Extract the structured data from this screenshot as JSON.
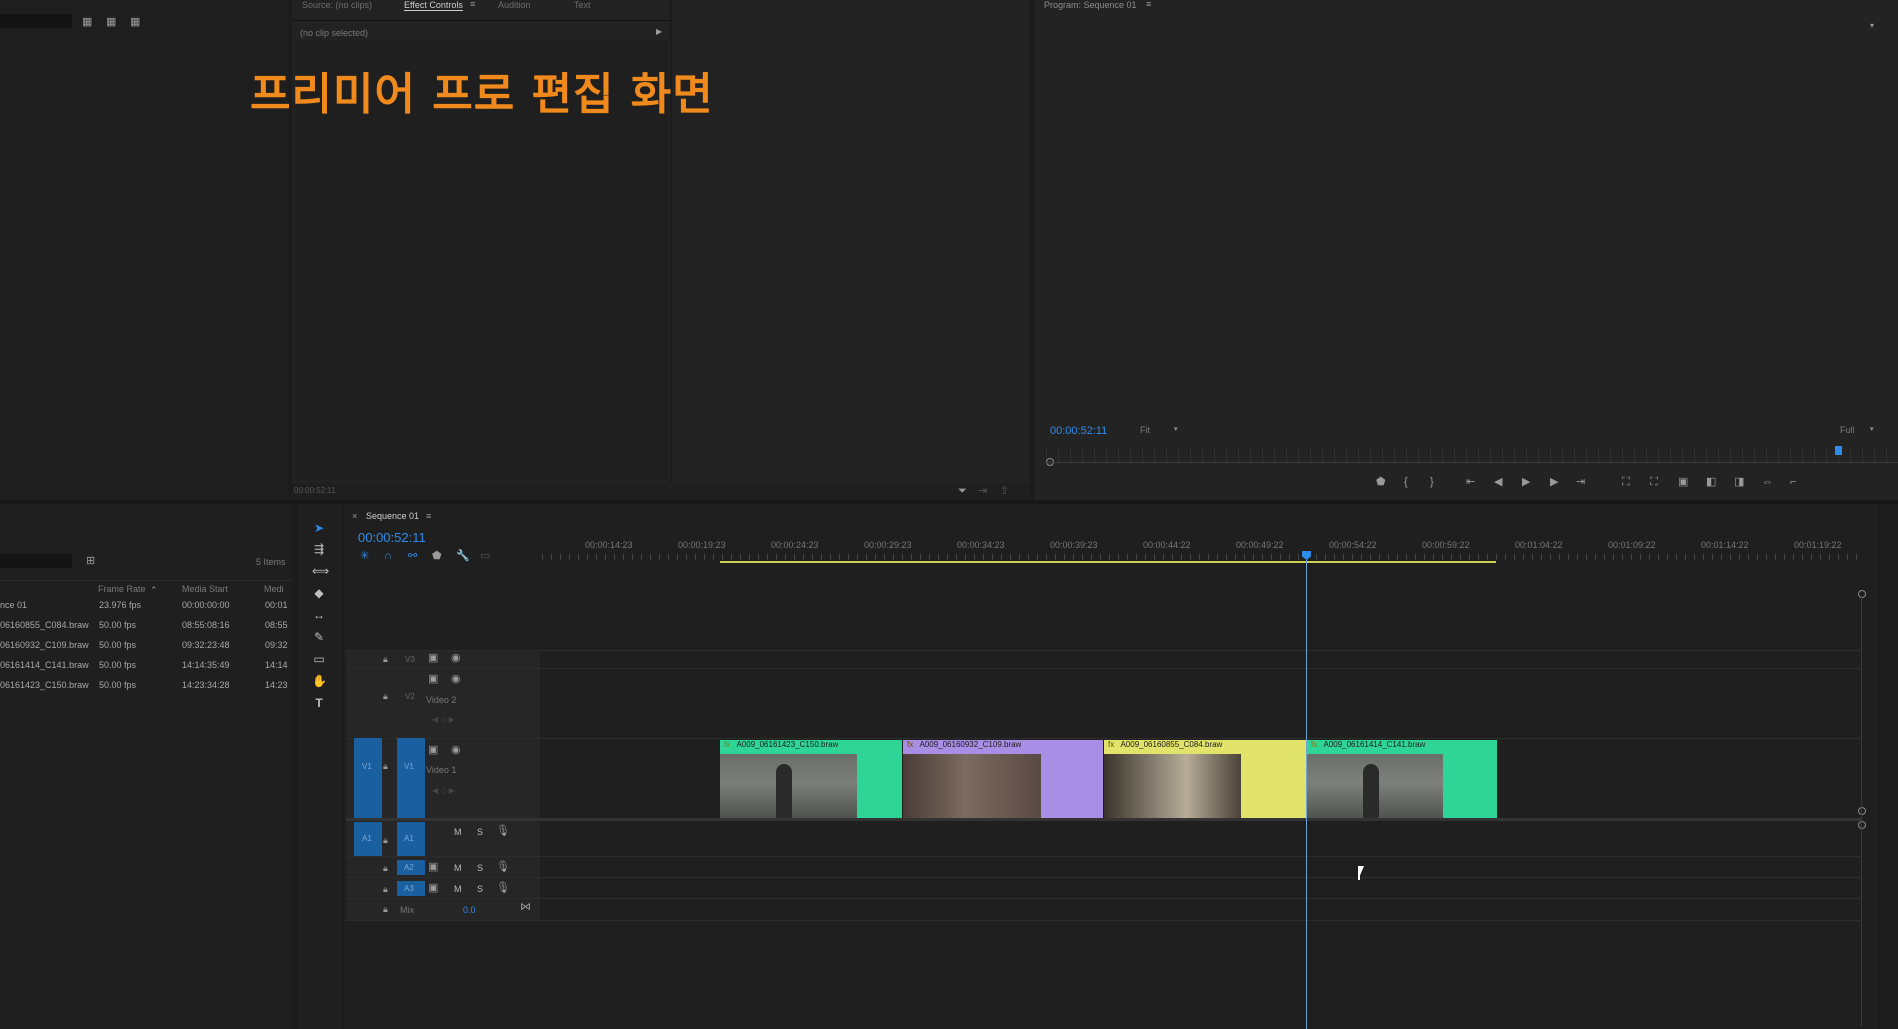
{
  "overlay_title": "프리미어 프로 편집 화면",
  "source_panel": {
    "tabs": [
      "Source: (no clips)",
      "Effect Controls",
      "Audition",
      "Text"
    ],
    "active_tab": "Effect Controls",
    "no_clip_text": "(no clip selected)",
    "timecode": "00:00:52:11"
  },
  "program_monitor": {
    "title": "Program: Sequence 01",
    "timecode": "00:00:52:11",
    "fit": "Fit",
    "resolution": "Full"
  },
  "project_panel": {
    "item_count": "5 Items",
    "columns": [
      "Frame Rate",
      "Media Start",
      "Medi"
    ],
    "rows": [
      {
        "name": "nce 01",
        "fps": "23.976 fps",
        "start": "00:00:00:00",
        "end": "00:01"
      },
      {
        "name": "06160855_C084.braw",
        "fps": "50.00 fps",
        "start": "08:55:08:16",
        "end": "08:55"
      },
      {
        "name": "06160932_C109.braw",
        "fps": "50.00 fps",
        "start": "09:32:23:48",
        "end": "09:32"
      },
      {
        "name": "06161414_C141.braw",
        "fps": "50.00 fps",
        "start": "14:14:35:49",
        "end": "14:14"
      },
      {
        "name": "06161423_C150.braw",
        "fps": "50.00 fps",
        "start": "14:23:34:28",
        "end": "14:23"
      }
    ]
  },
  "timeline": {
    "sequence_name": "Sequence 01",
    "timecode": "00:00:52:11",
    "ruler": [
      "00:00:14:23",
      "00:00:19:23",
      "00:00:24:23",
      "00:00:29:23",
      "00:00:34:23",
      "00:00:39:23",
      "00:00:44:22",
      "00:00:49:22",
      "00:00:54:22",
      "00:00:59:22",
      "00:01:04:22",
      "00:01:09:22",
      "00:01:14:22",
      "00:01:19:22"
    ],
    "tracks": {
      "v3": "V3",
      "v2": "V2",
      "v2_name": "Video 2",
      "v1": "V1",
      "v1_name": "Video 1",
      "a1": "A1",
      "a2": "A2",
      "a3": "A3",
      "mix": "Mix",
      "mix_value": "0.0",
      "m": "M",
      "s": "S"
    },
    "clips": [
      {
        "name": "A009_06161423_C150.braw",
        "color": "#2fd597"
      },
      {
        "name": "A009_06160932_C109.braw",
        "color": "#a98ee6"
      },
      {
        "name": "A009_06160855_C084.braw",
        "color": "#e2e36b"
      },
      {
        "name": "A009_06161414_C141.braw",
        "color": "#2fd597"
      }
    ]
  },
  "colors": {
    "accent_blue": "#2d8ceb",
    "title_orange": "#f08a1c",
    "track_blue": "#1a5fa0",
    "work_area": "#cfd04e"
  }
}
